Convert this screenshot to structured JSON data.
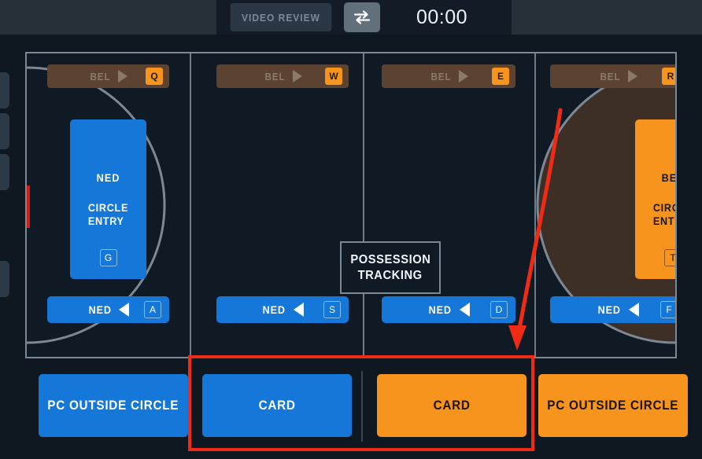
{
  "topbar": {
    "video_review_label": "VIDEO REVIEW",
    "swap_icon": "swap-arrows-icon",
    "timer": "00:00"
  },
  "colors": {
    "team_home": "#1578d8",
    "team_away": "#f7941e",
    "background": "#101a24",
    "topbar": "#263038",
    "pitch_line": "#7c8994",
    "goal": "#cf1f18",
    "annotation": "#ef2b16",
    "away_circle_fill": "#3d2f26",
    "away_bar": "#5c4231"
  },
  "teams": {
    "home": "NED",
    "away": "BEL"
  },
  "pitch": {
    "possession_tracking_line1": "POSSESSION",
    "possession_tracking_line2": "TRACKING",
    "quarters": [
      {
        "top_bar": {
          "team": "BEL",
          "direction": "right",
          "key": "Q"
        },
        "bottom_bar": {
          "team": "NED",
          "direction": "left",
          "key": "A"
        },
        "circle_entry": {
          "team": "NED",
          "action_line1": "CIRCLE",
          "action_line2": "ENTRY",
          "key": "G",
          "color": "blue"
        }
      },
      {
        "top_bar": {
          "team": "BEL",
          "direction": "right",
          "key": "W"
        },
        "bottom_bar": {
          "team": "NED",
          "direction": "left",
          "key": "S"
        },
        "circle_entry": null
      },
      {
        "top_bar": {
          "team": "BEL",
          "direction": "right",
          "key": "E"
        },
        "bottom_bar": {
          "team": "NED",
          "direction": "left",
          "key": "D"
        },
        "circle_entry": null
      },
      {
        "top_bar": {
          "team": "BEL",
          "direction": "right",
          "key": "R"
        },
        "bottom_bar": {
          "team": "NED",
          "direction": "left",
          "key": "F"
        },
        "circle_entry": {
          "team": "BEL",
          "action_line1": "CIRCLE",
          "action_line2": "ENTRY",
          "key": "T",
          "color": "orange"
        }
      }
    ]
  },
  "actions": [
    {
      "label": "PC OUTSIDE CIRCLE",
      "color": "blue"
    },
    {
      "label": "CARD",
      "color": "blue"
    },
    {
      "label": "CARD",
      "color": "orange"
    },
    {
      "label": "PC OUTSIDE CIRCLE",
      "color": "orange"
    }
  ]
}
